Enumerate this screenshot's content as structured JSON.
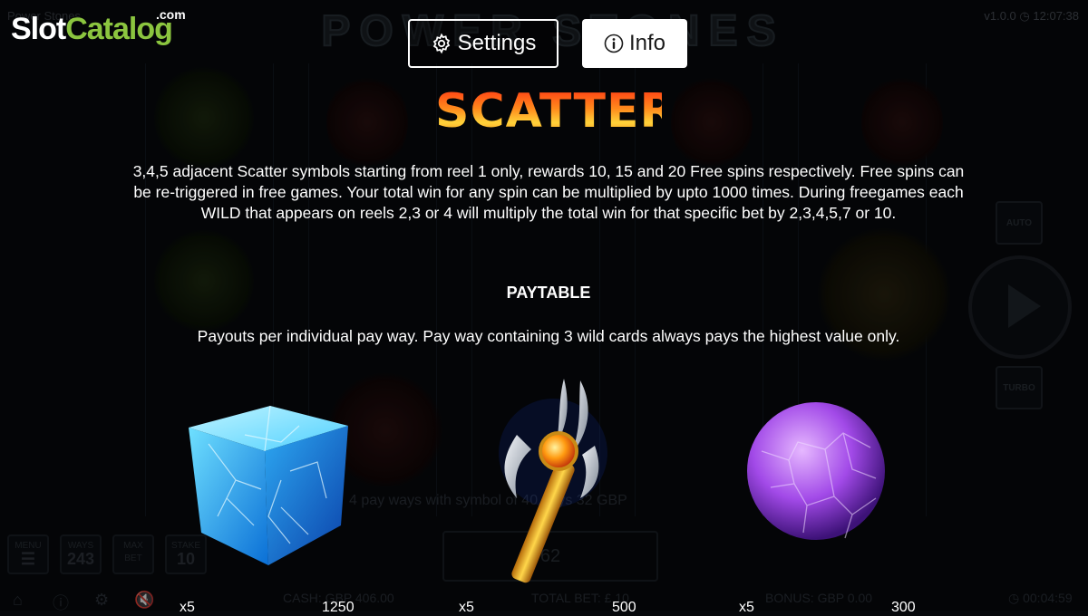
{
  "branding": {
    "slot": "Slot",
    "catalog": "Catalog",
    "com": ".com"
  },
  "tabs": {
    "settings_label": "Settings",
    "info_label": "Info"
  },
  "background": {
    "game_title": "Power Stones",
    "logo_text": "POWER STONES",
    "version": "v1.0.0",
    "clock": "12:07:38",
    "auto_label": "AUTO",
    "turbo_label": "TURBO",
    "win_line": "4 pay ways with symbol of 40 pays 32 GBP",
    "panel_value": "62",
    "menu_label": "MENU",
    "ways_label": "WAYS",
    "ways_value": "243",
    "maxbet_label": "MAX BET",
    "stake_label": "STAKE",
    "stake_value": "10",
    "cash": "CASH: GBP 406.00",
    "total_bet": "TOTAL BET: £ 10",
    "bonus": "BONUS: GBP 0.00",
    "timer": "00:04:59"
  },
  "info": {
    "scatter_title": "SCATTER",
    "description": "3,4,5 adjacent Scatter symbols starting from reel 1 only, rewards 10, 15 and 20 Free spins respectively. Free spins can be re-triggered in free games. Your total win for any spin can be multiplied by upto 1000 times. During freegames each WILD that appears on reels 2,3 or 4 will multiply the total win for that specific bet by 2,3,4,5,7 or 10.",
    "paytable_heading": "PAYTABLE",
    "payouts_note": "Payouts per individual pay way. Pay way containing 3 wild cards always pays the highest value only."
  },
  "paytable": [
    {
      "symbol": "ice-cube",
      "multiplier": "x5",
      "payout": "1250"
    },
    {
      "symbol": "golden-staff",
      "multiplier": "x5",
      "payout": "500"
    },
    {
      "symbol": "purple-orb",
      "multiplier": "x5",
      "payout": "300"
    }
  ]
}
